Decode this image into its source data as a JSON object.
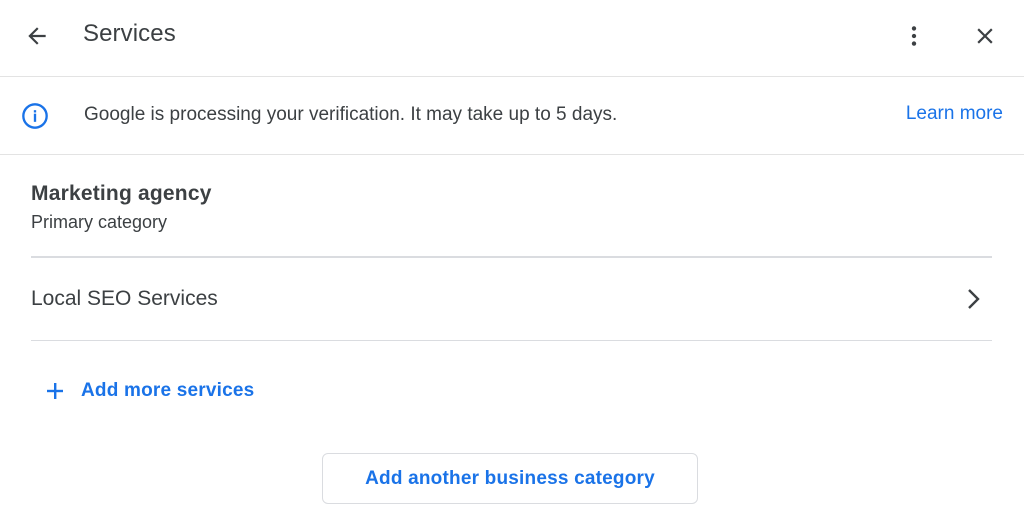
{
  "header": {
    "title": "Services",
    "back_icon": "arrow-left-icon",
    "more_icon": "more-vertical-icon",
    "close_icon": "close-icon"
  },
  "notice": {
    "icon": "info-icon",
    "message": "Google is processing your verification. It may take up to 5 days.",
    "link_label": "Learn more"
  },
  "primary_category": {
    "name": "Marketing agency",
    "subtitle": "Primary category"
  },
  "services": [
    {
      "label": "Local SEO Services",
      "icon": "chevron-right-icon"
    }
  ],
  "actions": {
    "add_services_label": "Add more services",
    "add_category_label": "Add another business category"
  },
  "colors": {
    "accent": "#1a73e8",
    "text": "#3c4043",
    "divider": "#dadce0"
  }
}
